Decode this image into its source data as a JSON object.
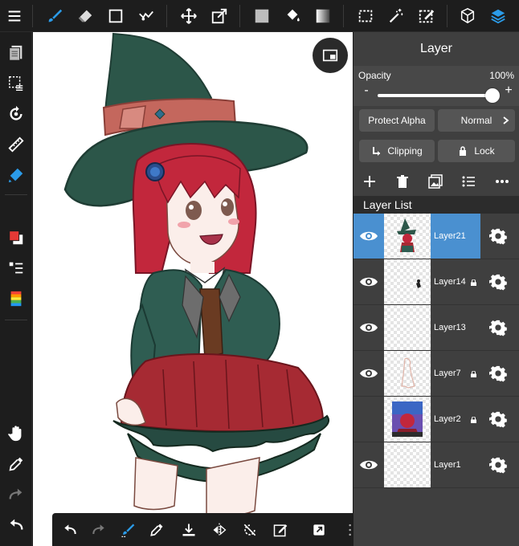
{
  "colors": {
    "accent": "#2b9be8",
    "selected_layer": "#4a90d0",
    "primary_color": "#e53935",
    "secondary_color": "#ffffff"
  },
  "top_toolbar": {
    "tools": [
      "menu-icon",
      "brush-icon",
      "eraser-icon",
      "rectangle-icon",
      "lasso-icon",
      "move-icon",
      "transform-icon",
      "fill-color-icon",
      "bucket-icon",
      "gradient-icon",
      "selection-icon",
      "magic-wand-icon",
      "selection-pen-icon",
      "3d-icon",
      "layers-icon"
    ]
  },
  "left_toolbar": {
    "tools": [
      "pages-icon",
      "select-layer-icon",
      "rotate-icon",
      "ruler-icon",
      "fill-pen-icon",
      "color-icon",
      "layer-order-icon",
      "palette-icon",
      "hand-icon",
      "eyedropper-icon",
      "redo-icon",
      "undo-icon"
    ]
  },
  "bottom_toolbar": {
    "tools": [
      "undo-icon",
      "redo-icon",
      "brush-settings-icon",
      "eyedropper-icon",
      "save-icon",
      "flip-icon",
      "rotate-reset-icon",
      "edit-icon",
      "export-icon",
      "grid-icon"
    ]
  },
  "panel": {
    "title": "Layer",
    "opacity_label": "Opacity",
    "opacity_value": "100%",
    "opacity_fraction": 1.0,
    "minus": "-",
    "plus": "+",
    "protect_alpha": "Protect Alpha",
    "blend_mode": "Normal",
    "clipping": "Clipping",
    "lock": "Lock",
    "layer_list_title": "Layer List"
  },
  "layers": [
    {
      "name": "Layer21",
      "visible": true,
      "locked": false,
      "selected": true
    },
    {
      "name": "Layer14",
      "visible": true,
      "locked": true,
      "selected": false
    },
    {
      "name": "Layer13",
      "visible": true,
      "locked": false,
      "selected": false
    },
    {
      "name": "Layer7",
      "visible": true,
      "locked": true,
      "selected": false
    },
    {
      "name": "Layer2",
      "visible": false,
      "locked": true,
      "selected": false
    },
    {
      "name": "Layer1",
      "visible": true,
      "locked": false,
      "selected": false
    }
  ]
}
